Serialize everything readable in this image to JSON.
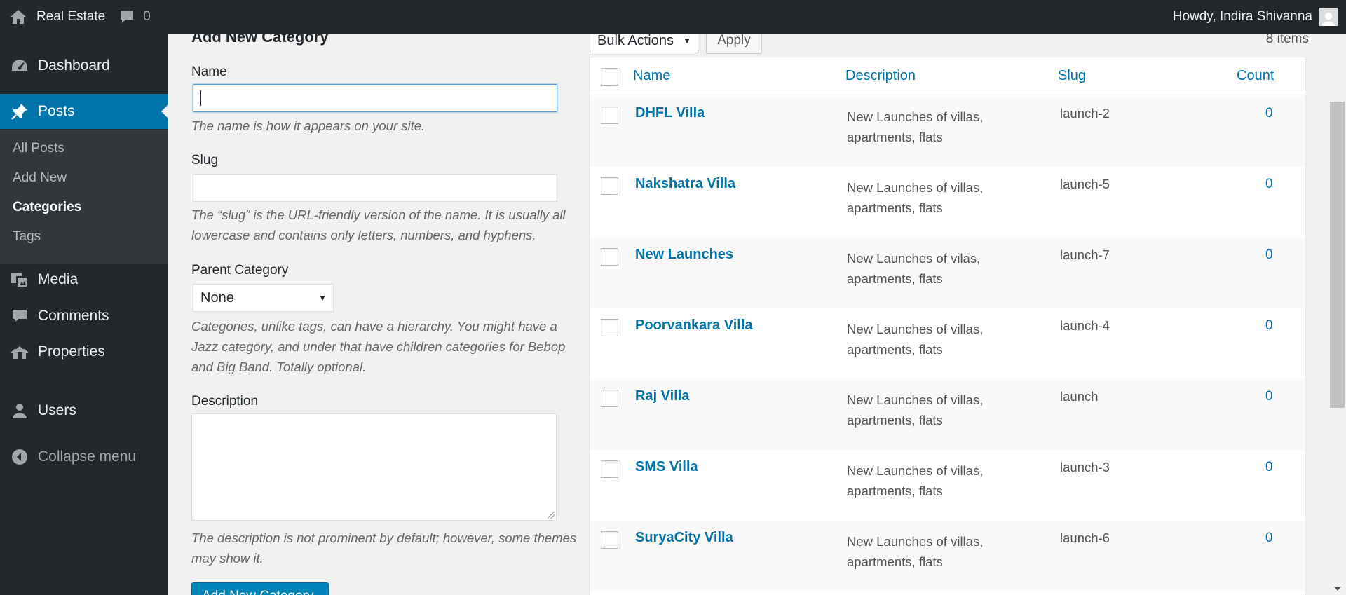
{
  "adminbar": {
    "site_name": "Real Estate",
    "comments_count": "0",
    "howdy": "Howdy, Indira Shivanna"
  },
  "sidebar": {
    "items": [
      {
        "label": "Dashboard",
        "icon": "dashboard-icon"
      },
      {
        "label": "Posts",
        "icon": "pin-icon",
        "current": true
      },
      {
        "label": "Media",
        "icon": "media-icon"
      },
      {
        "label": "Comments",
        "icon": "comment-icon"
      },
      {
        "label": "Properties",
        "icon": "properties-icon"
      },
      {
        "label": "Users",
        "icon": "user-icon"
      }
    ],
    "submenu": [
      "All Posts",
      "Add New",
      "Categories",
      "Tags"
    ],
    "collapse_label": "Collapse menu"
  },
  "form": {
    "title": "Add New Category",
    "name_label": "Name",
    "name_value": "",
    "name_help": "The name is how it appears on your site.",
    "slug_label": "Slug",
    "slug_value": "",
    "slug_help": "The “slug” is the URL-friendly version of the name. It is usually all lowercase and contains only letters, numbers, and hyphens.",
    "parent_label": "Parent Category",
    "parent_value": "None",
    "parent_help": "Categories, unlike tags, can have a hierarchy. You might have a Jazz category, and under that have children categories for Bebop and Big Band. Totally optional.",
    "description_label": "Description",
    "description_value": "",
    "description_help": "The description is not prominent by default; however, some themes may show it.",
    "submit_label": "Add New Category"
  },
  "tablenav": {
    "bulk_actions": "Bulk Actions",
    "apply": "Apply",
    "items_count": "8 items"
  },
  "table": {
    "columns": {
      "name": "Name",
      "description": "Description",
      "slug": "Slug",
      "count": "Count"
    },
    "rows": [
      {
        "name": "DHFL Villa",
        "description": "New Launches of villas, apartments, flats",
        "slug": "launch-2",
        "count": "0"
      },
      {
        "name": "Nakshatra Villa",
        "description": "New Launches of villas, apartments, flats",
        "slug": "launch-5",
        "count": "0"
      },
      {
        "name": "New Launches",
        "description": "New Launches of vilas, apartments, flats",
        "slug": "launch-7",
        "count": "0"
      },
      {
        "name": "Poorvankara Villa",
        "description": "New Launches of villas, apartments, flats",
        "slug": "launch-4",
        "count": "0"
      },
      {
        "name": "Raj Villa",
        "description": "New Launches of villas, apartments, flats",
        "slug": "launch",
        "count": "0"
      },
      {
        "name": "SMS Villa",
        "description": "New Launches of villas, apartments, flats",
        "slug": "launch-3",
        "count": "0"
      },
      {
        "name": "SuryaCity Villa",
        "description": "New Launches of villas, apartments, flats",
        "slug": "launch-6",
        "count": "0"
      }
    ]
  },
  "colors": {
    "accent": "#0073aa",
    "sidebar_bg": "#23282d",
    "submenu_bg": "#32373c",
    "primary_button": "#0085ba"
  }
}
